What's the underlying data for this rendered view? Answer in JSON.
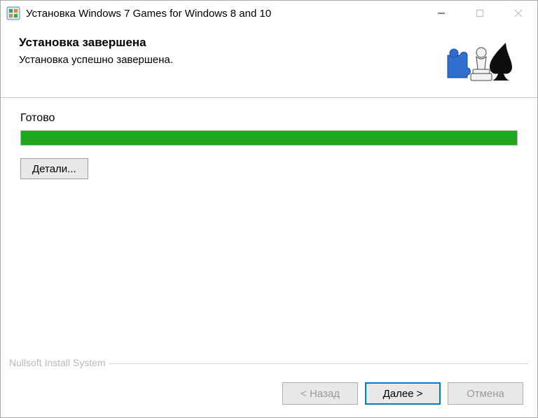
{
  "titlebar": {
    "title": "Установка Windows 7 Games for Windows 8 and 10"
  },
  "header": {
    "title": "Установка завершена",
    "subtitle": "Установка успешно завершена."
  },
  "content": {
    "status": "Готово",
    "progress_pct": 100,
    "details_label": "Детали..."
  },
  "footer": {
    "frame_label": "Nullsoft Install System",
    "back_label": "< Назад",
    "next_label": "Далее >",
    "cancel_label": "Отмена"
  },
  "colors": {
    "progress_fill": "#1ca81c",
    "accent": "#0078d7"
  }
}
